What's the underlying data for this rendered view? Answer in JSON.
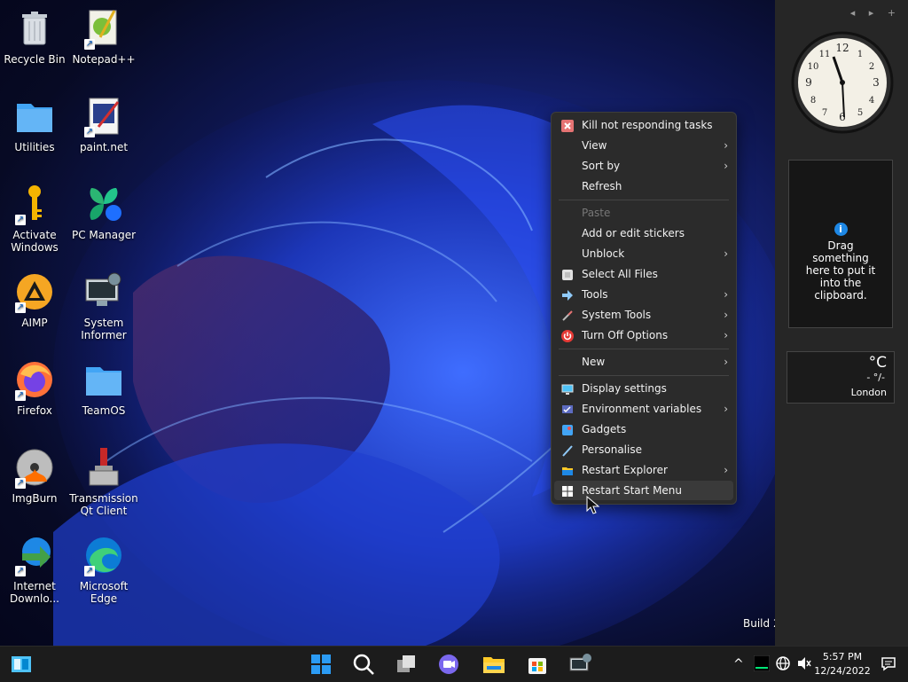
{
  "desktop": {
    "icons": [
      {
        "label": "Recycle Bin",
        "icon": "recycle-bin-icon"
      },
      {
        "label": "Notepad++",
        "icon": "notepadpp-icon"
      },
      {
        "label": "Utilities",
        "icon": "folder-icon"
      },
      {
        "label": "paint.net",
        "icon": "paintnet-icon"
      },
      {
        "label": "Activate Windows",
        "icon": "key-icon"
      },
      {
        "label": "PC Manager",
        "icon": "pc-manager-icon"
      },
      {
        "label": "AIMP",
        "icon": "aimp-icon"
      },
      {
        "label": "System Informer",
        "icon": "system-informer-icon"
      },
      {
        "label": "Firefox",
        "icon": "firefox-icon"
      },
      {
        "label": "TeamOS",
        "icon": "folder-icon"
      },
      {
        "label": "ImgBurn",
        "icon": "imgburn-icon"
      },
      {
        "label": "Transmission Qt Client",
        "icon": "transmission-icon"
      },
      {
        "label": "Internet Downlo...",
        "icon": "idm-icon"
      },
      {
        "label": "Microsoft Edge",
        "icon": "edge-icon"
      }
    ],
    "build_text": "Build 2"
  },
  "sidebar": {
    "nav": "◂ ▸ +",
    "clipboard_text": "Drag something here to put it into the clipboard.",
    "weather": {
      "unit": "°C",
      "value": "- °/-",
      "city": "London"
    }
  },
  "context_menu": {
    "items": [
      {
        "label": "Kill not responding tasks",
        "icon": "kill-icon",
        "submenu": false
      },
      {
        "label": "View",
        "submenu": true
      },
      {
        "label": "Sort by",
        "submenu": true
      },
      {
        "label": "Refresh",
        "submenu": false
      },
      {
        "label": "Paste",
        "submenu": false,
        "disabled": true
      },
      {
        "label": "Add or edit stickers",
        "submenu": false
      },
      {
        "label": "Unblock",
        "submenu": true
      },
      {
        "label": "Select All Files",
        "icon": "select-all-icon",
        "submenu": false
      },
      {
        "label": "Tools",
        "icon": "tools-icon",
        "submenu": true
      },
      {
        "label": "System Tools",
        "icon": "system-tools-icon",
        "submenu": true
      },
      {
        "label": "Turn Off Options",
        "icon": "power-icon",
        "submenu": true
      },
      {
        "label": "New",
        "submenu": true
      },
      {
        "label": "Display settings",
        "icon": "display-icon",
        "submenu": false
      },
      {
        "label": "Environment variables",
        "icon": "env-icon",
        "submenu": true
      },
      {
        "label": "Gadgets",
        "icon": "gadgets-icon",
        "submenu": false
      },
      {
        "label": "Personalise",
        "icon": "brush-icon",
        "submenu": false
      },
      {
        "label": "Restart Explorer",
        "icon": "explorer-icon",
        "submenu": true
      },
      {
        "label": "Restart Start Menu",
        "icon": "windows-icon",
        "submenu": false,
        "highlighted": true
      }
    ],
    "submenu_glyph": "›"
  },
  "taskbar": {
    "time": "5:57 PM",
    "date": "12/24/2022"
  },
  "colors": {
    "accent": "#1e88e5",
    "menu_bg": "#2b2b2b",
    "taskbar_bg": "#1c1c1c"
  }
}
